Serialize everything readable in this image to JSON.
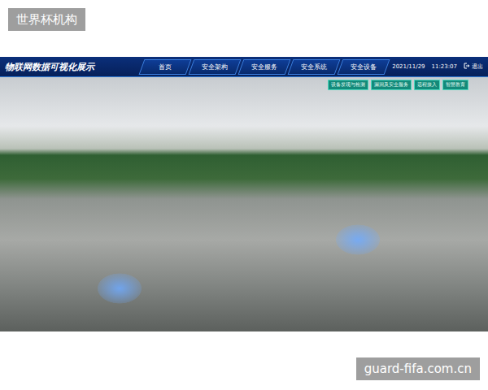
{
  "badge": "世界杯机构",
  "app": {
    "title": "物联网数据可视化展示",
    "nav": [
      "首页",
      "安全架构",
      "安全服务",
      "安全系统",
      "安全设备"
    ],
    "date": "2021/11/29",
    "time": "11:23:07",
    "logout": "退出",
    "sub_buttons": [
      "设备发现与检测",
      "漏洞及安全服务",
      "远程接入",
      "智慧教育"
    ]
  },
  "footer": "guard-fifa.com.cn"
}
